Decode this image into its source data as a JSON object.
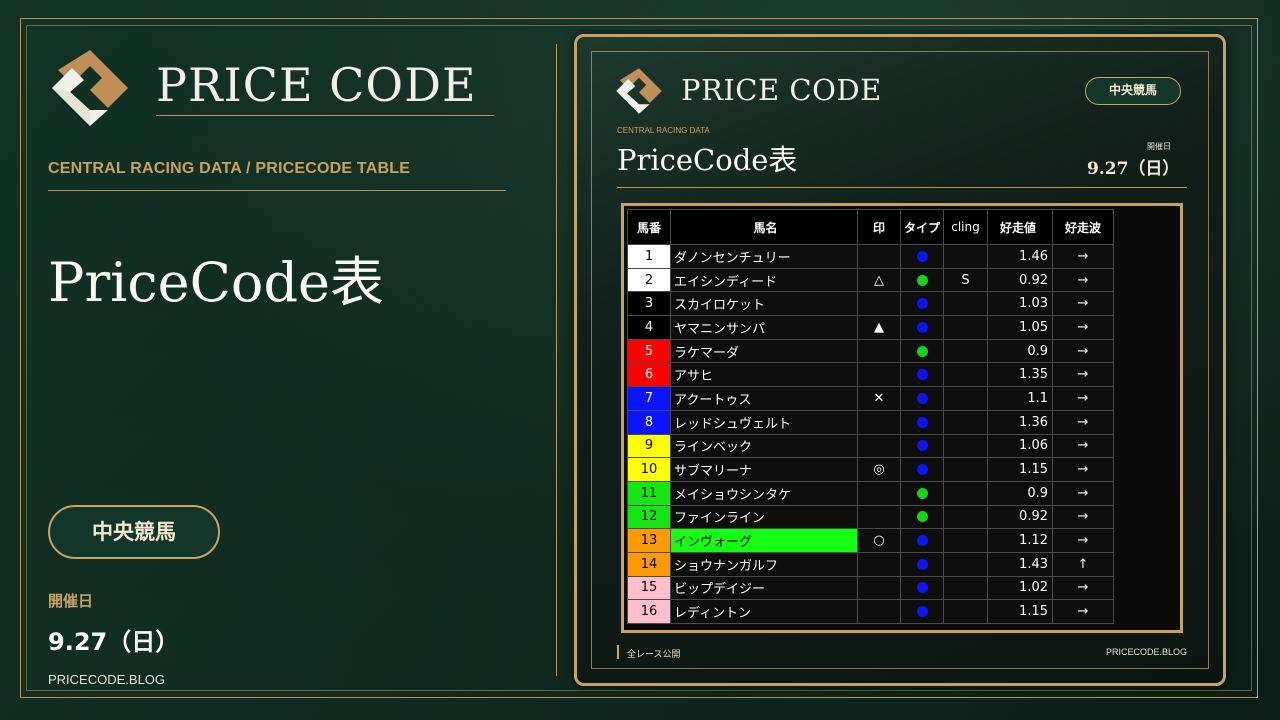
{
  "brand": {
    "name": "PRICE CODE"
  },
  "left": {
    "subheading": "CENTRAL RACING DATA / PRICECODE TABLE",
    "title": "PriceCode表",
    "category_pill": "中央競馬",
    "date_label": "開催日",
    "date_value": "9.27（日）",
    "site": "PRICECODE.BLOG"
  },
  "card": {
    "brand": "PRICE CODE",
    "pill": "中央競馬",
    "subheading": "CENTRAL RACING DATA",
    "title": "PriceCode表",
    "date_label": "開催日",
    "date_value": "9.27（日）",
    "footer_left": "全レース公開",
    "footer_right": "PRICECODE.BLOG"
  },
  "colors": {
    "gold": "#c9a261",
    "background": "#0f2a20",
    "dot_blue": "#0a14ff",
    "dot_green": "#12d612"
  },
  "table": {
    "headers": [
      "馬番",
      "馬名",
      "印",
      "タイプ",
      "cling",
      "好走値",
      "好走波"
    ],
    "rows": [
      {
        "num": "1",
        "name": "ダノンセンチュリー",
        "mark": "",
        "type": "blue",
        "cling": "",
        "value": "1.46",
        "wave": "→",
        "num_bg": "#ffffff",
        "num_fg": "#000000",
        "name_bg": ""
      },
      {
        "num": "2",
        "name": "エイシンディード",
        "mark": "△",
        "type": "green",
        "cling": "S",
        "value": "0.92",
        "wave": "→",
        "num_bg": "#ffffff",
        "num_fg": "#000000",
        "name_bg": ""
      },
      {
        "num": "3",
        "name": "スカイロケット",
        "mark": "",
        "type": "blue",
        "cling": "",
        "value": "1.03",
        "wave": "→",
        "num_bg": "#000000",
        "num_fg": "#ffffff",
        "name_bg": ""
      },
      {
        "num": "4",
        "name": "ヤマニンサンパ",
        "mark": "▲",
        "type": "blue",
        "cling": "",
        "value": "1.05",
        "wave": "→",
        "num_bg": "#000000",
        "num_fg": "#ffffff",
        "name_bg": ""
      },
      {
        "num": "5",
        "name": "ラケマーダ",
        "mark": "",
        "type": "green",
        "cling": "",
        "value": "0.9",
        "wave": "→",
        "num_bg": "#ff0000",
        "num_fg": "#ffffff",
        "name_bg": ""
      },
      {
        "num": "6",
        "name": "アサヒ",
        "mark": "",
        "type": "blue",
        "cling": "",
        "value": "1.35",
        "wave": "→",
        "num_bg": "#ff0000",
        "num_fg": "#ffffff",
        "name_bg": ""
      },
      {
        "num": "7",
        "name": "アクートゥス",
        "mark": "✕",
        "type": "blue",
        "cling": "",
        "value": "1.1",
        "wave": "→",
        "num_bg": "#0a14ff",
        "num_fg": "#ffffff",
        "name_bg": ""
      },
      {
        "num": "8",
        "name": "レッドシュヴェルト",
        "mark": "",
        "type": "blue",
        "cling": "",
        "value": "1.36",
        "wave": "→",
        "num_bg": "#0a14ff",
        "num_fg": "#ffffff",
        "name_bg": ""
      },
      {
        "num": "9",
        "name": "ラインベック",
        "mark": "",
        "type": "blue",
        "cling": "",
        "value": "1.06",
        "wave": "→",
        "num_bg": "#ffff00",
        "num_fg": "#000000",
        "name_bg": ""
      },
      {
        "num": "10",
        "name": "サブマリーナ",
        "mark": "◎",
        "type": "blue",
        "cling": "",
        "value": "1.15",
        "wave": "→",
        "num_bg": "#ffff00",
        "num_fg": "#000000",
        "name_bg": ""
      },
      {
        "num": "11",
        "name": "メイショウシンタケ",
        "mark": "",
        "type": "green",
        "cling": "",
        "value": "0.9",
        "wave": "→",
        "num_bg": "#14e614",
        "num_fg": "#000000",
        "name_bg": ""
      },
      {
        "num": "12",
        "name": "ファインライン",
        "mark": "",
        "type": "green",
        "cling": "",
        "value": "0.92",
        "wave": "→",
        "num_bg": "#14e614",
        "num_fg": "#000000",
        "name_bg": ""
      },
      {
        "num": "13",
        "name": "インヴォーグ",
        "mark": "○",
        "type": "blue",
        "cling": "",
        "value": "1.12",
        "wave": "→",
        "num_bg": "#ff9900",
        "num_fg": "#000000",
        "name_bg": "#14ff14"
      },
      {
        "num": "14",
        "name": "ショウナンガルフ",
        "mark": "",
        "type": "blue",
        "cling": "",
        "value": "1.43",
        "wave": "↑",
        "num_bg": "#ff9900",
        "num_fg": "#000000",
        "name_bg": ""
      },
      {
        "num": "15",
        "name": "ビップデイジー",
        "mark": "",
        "type": "blue",
        "cling": "",
        "value": "1.02",
        "wave": "→",
        "num_bg": "#ffc0cb",
        "num_fg": "#000000",
        "name_bg": ""
      },
      {
        "num": "16",
        "name": "レディントン",
        "mark": "",
        "type": "blue",
        "cling": "",
        "value": "1.15",
        "wave": "→",
        "num_bg": "#ffc0cb",
        "num_fg": "#000000",
        "name_bg": ""
      }
    ]
  }
}
